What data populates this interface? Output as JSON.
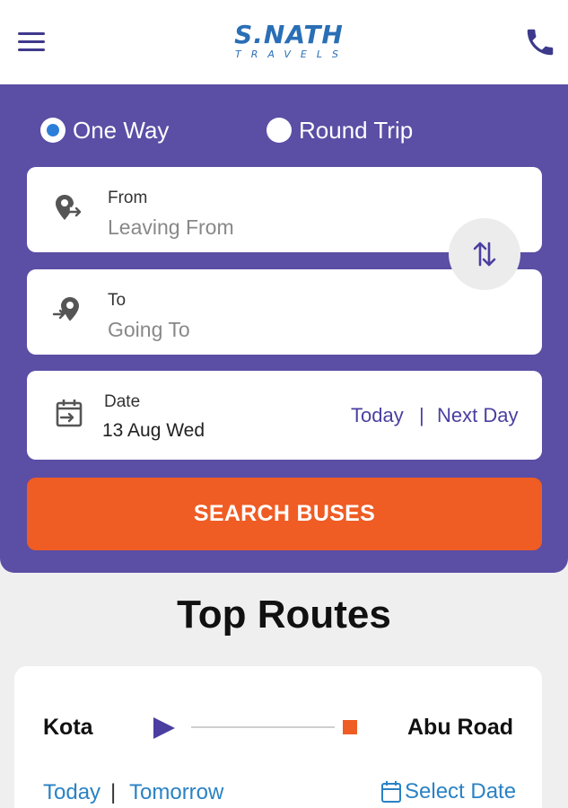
{
  "header": {
    "logo_main": "S.NATH",
    "logo_sub": "TRAVELS"
  },
  "trip_type": {
    "one_way": "One Way",
    "round_trip": "Round Trip",
    "selected": "one_way"
  },
  "from": {
    "label": "From",
    "placeholder": "Leaving From"
  },
  "to": {
    "label": "To",
    "placeholder": "Going To"
  },
  "date": {
    "label": "Date",
    "value": "13 Aug Wed",
    "today": "Today",
    "separator": "|",
    "next_day": "Next Day"
  },
  "search_button": "SEARCH BUSES",
  "top_routes": {
    "title": "Top Routes",
    "routes": [
      {
        "from": "Kota",
        "to": "Abu Road",
        "today": "Today",
        "separator": "|",
        "tomorrow": "Tomorrow",
        "select_date": "Select Date"
      }
    ]
  },
  "colors": {
    "brand_purple": "#5b4ea5",
    "accent_orange": "#ef5c24",
    "link_blue": "#2a82c4",
    "logo_blue": "#2a6fb5"
  },
  "icons": [
    "menu-icon",
    "phone-icon",
    "location-depart-icon",
    "location-arrive-icon",
    "swap-icon",
    "calendar-icon",
    "route-start-icon",
    "route-end-icon"
  ]
}
